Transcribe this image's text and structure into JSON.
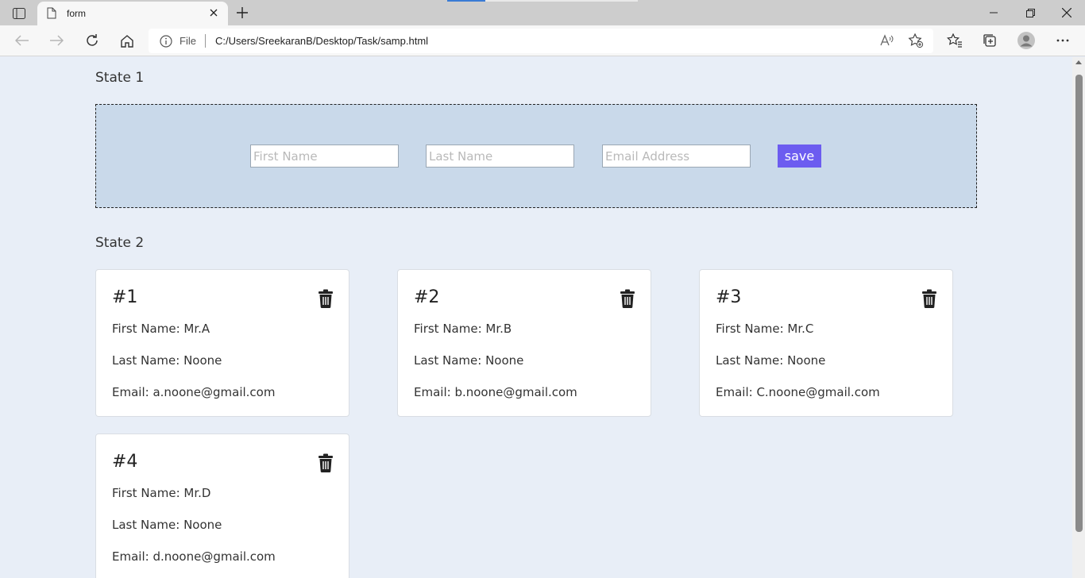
{
  "browser": {
    "tab_title": "form",
    "address_scheme": "File",
    "address_url": "C:/Users/SreekaranB/Desktop/Task/samp.html"
  },
  "page": {
    "state1_label": "State 1",
    "state2_label": "State 2",
    "form": {
      "first_name_placeholder": "First Name",
      "last_name_placeholder": "Last Name",
      "email_placeholder": "Email Address",
      "save_label": "save"
    },
    "cards": [
      {
        "num": "#1",
        "first": "First Name: Mr.A",
        "last": "Last Name: Noone",
        "email": "Email: a.noone@gmail.com"
      },
      {
        "num": "#2",
        "first": "First Name: Mr.B",
        "last": "Last Name: Noone",
        "email": "Email: b.noone@gmail.com"
      },
      {
        "num": "#3",
        "first": "First Name: Mr.C",
        "last": "Last Name: Noone",
        "email": "Email: C.noone@gmail.com"
      },
      {
        "num": "#4",
        "first": "First Name: Mr.D",
        "last": "Last Name: Noone",
        "email": "Email: d.noone@gmail.com"
      }
    ]
  },
  "colors": {
    "page_bg": "#e8eef7",
    "form_bg": "#c9d9ea",
    "save_button": "#6c5cf0"
  }
}
